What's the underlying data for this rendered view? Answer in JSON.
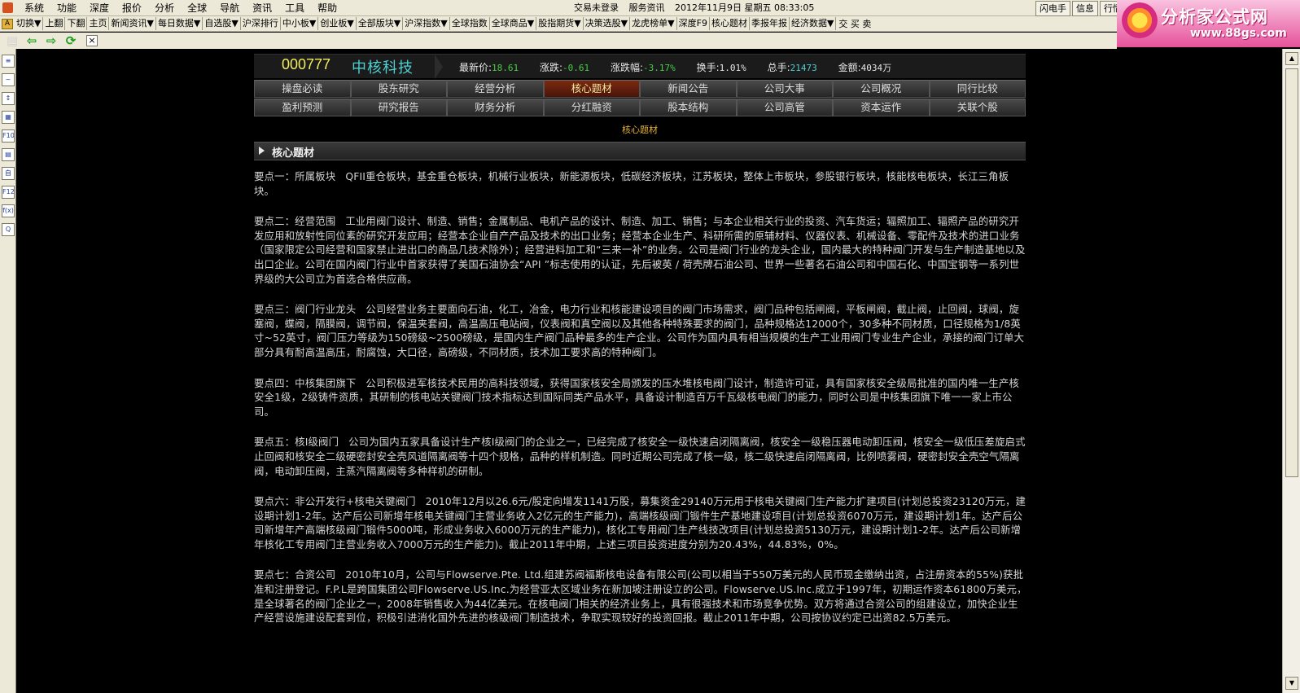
{
  "menubar": {
    "items": [
      "系统",
      "功能",
      "深度",
      "报价",
      "分析",
      "全球",
      "导航",
      "资讯",
      "工具",
      "帮助"
    ],
    "trade_status": "交易未登录",
    "service": "服务资讯",
    "datetime": "2012年11月9日 星期五 08:33:05",
    "right_buttons": [
      "闪电手",
      "信息",
      "行情"
    ]
  },
  "brand": {
    "name": "分析家公式网",
    "url": "www.88gs.com"
  },
  "toolbar": {
    "lead": "A",
    "items": [
      "切换▼",
      "上翻",
      "下翻",
      "主页",
      "新闻资讯▼",
      "每日数据▼",
      "自选股▼",
      "沪深排行",
      "中小板▼",
      "创业板▼",
      "全部版块▼",
      "沪深指数▼",
      "全球指数",
      "全球商品▼",
      "股指期货▼",
      "决策选股▼",
      "龙虎榜单▼",
      "深度F9",
      "核心题材",
      "季报年报",
      "经济数据▼"
    ],
    "end": "交 买 卖"
  },
  "navbar": {
    "close": "×"
  },
  "left_tools": [
    "≡",
    "~",
    "↕",
    "▦",
    "F10",
    "▤",
    "自",
    "F12",
    "f(x)",
    "Q"
  ],
  "stock": {
    "code": "000777",
    "name": "中核科技",
    "price_label": "最新价:",
    "price": "18.61",
    "change_label": "涨跌:",
    "change": "-0.61",
    "pct_label": "涨跌幅:",
    "pct": "-3.17%",
    "turnover_label": "换手:",
    "turnover": "1.01%",
    "volume_label": "总手:",
    "volume": "21473",
    "amount_label": "金额:",
    "amount": "4034万"
  },
  "colors": {
    "price": "#44d044",
    "change": "#44d044",
    "pct": "#44d044",
    "turnover": "#e6e6e6",
    "volume": "#4fd0d0",
    "amount": "#e6e6e6"
  },
  "tabs": {
    "row1": [
      "操盘必读",
      "股东研究",
      "经营分析",
      "核心题材",
      "新闻公告",
      "公司大事",
      "公司概况",
      "同行比较"
    ],
    "row2": [
      "盈利预测",
      "研究报告",
      "财务分析",
      "分红融资",
      "股本结构",
      "公司高管",
      "资本运作",
      "关联个股"
    ],
    "active": "核心题材"
  },
  "subtitle": "核心题材",
  "section": {
    "title": "核心题材"
  },
  "points": [
    {
      "title": "要点一：所属板块",
      "text": "QFII重仓板块，基金重仓板块，机械行业板块，新能源板块，低碳经济板块，江苏板块，整体上市板块，参股银行板块，核能核电板块，长江三角板块。"
    },
    {
      "title": "要点二：经营范围",
      "text": "工业用阀门设计、制造、销售；金属制品、电机产品的设计、制造、加工、销售；与本企业相关行业的投资、汽车货运；辐照加工、辐照产品的研究开发应用和放射性同位素的研究开发应用；经营本企业自产产品及技术的出口业务；经营本企业生产、科研所需的原辅材料、仪器仪表、机械设备、零配件及技术的进口业务（国家限定公司经营和国家禁止进出口的商品几技术除外）；经营进料加工和“三来一补”的业务。公司是阀门行业的龙头企业，国内最大的特种阀门开发与生产制造基地以及出口企业。公司在国内阀门行业中首家获得了美国石油协会“API ”标志使用的认证，先后被英 / 荷壳牌石油公司、世界一些著名石油公司和中国石化、中国宝钢等一系列世界级的大公司立为首选合格供应商。"
    },
    {
      "title": "要点三：阀门行业龙头",
      "text": "公司经营业务主要面向石油，化工，冶金，电力行业和核能建设项目的阀门市场需求，阀门品种包括闸阀，平板闸阀，截止阀，止回阀，球阀，旋塞阀，蝶阀，隔膜阀，调节阀，保温夹套阀，高温高压电站阀，仪表阀和真空阀以及其他各种特殊要求的阀门，品种规格达12000个，30多种不同材质，口径规格为1/8英寸~52英寸，阀门压力等级为150磅级~2500磅级，是国内生产阀门品种最多的生产企业。公司作为国内具有相当规模的生产工业用阀门专业生产企业，承接的阀门订单大部分具有耐高温高压，耐腐蚀，大口径，高磅级，不同材质，技术加工要求高的特种阀门。"
    },
    {
      "title": "要点四：中核集团旗下",
      "text": "公司积极进军核技术民用的高科技领域，获得国家核安全局颁发的压水堆核电阀门设计，制造许可证，具有国家核安全级局批准的国内唯一生产核安全1级，2级铸件资质，其研制的核电站关键阀门技术指标达到国际同类产品水平，具备设计制造百万千瓦级核电阀门的能力，同时公司是中核集团旗下唯一一家上市公司。"
    },
    {
      "title": "要点五：核I级阀门",
      "text": "公司为国内五家具备设计生产核I级阀门的企业之一，已经完成了核安全一级快速启闭隔离阀，核安全一级稳压器电动卸压阀，核安全一级低压差旋启式止回阀和核安全二级硬密封安全壳风道隔离阀等十四个规格，品种的样机制造。同时近期公司完成了核一级，核二级快速启闭隔离阀，比例喷雾阀，硬密封安全壳空气隔离阀，电动卸压阀，主蒸汽隔离阀等多种样机的研制。"
    },
    {
      "title": "要点六：非公开发行+核电关键阀门",
      "text": "2010年12月以26.6元/股定向增发1141万股，募集资金29140万元用于核电关键阀门生产能力扩建项目(计划总投资23120万元，建设期计划1-2年。达产后公司新增年核电关键阀门主营业务收入2亿元的生产能力)，高端核级阀门锻件生产基地建设项目(计划总投资6070万元，建设期计划1年。达产后公司新增年产高端核级阀门锻件5000吨，形成业务收入6000万元的生产能力)，核化工专用阀门生产线技改项目(计划总投资5130万元，建设期计划1-2年。达产后公司新增年核化工专用阀门主营业务收入7000万元的生产能力)。截止2011年中期，上述三项目投资进度分别为20.43%，44.83%，0%。"
    },
    {
      "title": "要点七：合资公司",
      "text": "2010年10月，公司与Flowserve.Pte. Ltd.组建苏阀福斯核电设备有限公司(公司以相当于550万美元的人民币现金缴纳出资，占注册资本的55%)获批准和注册登记。F.P.L是跨国集团公司Flowserve.US.Inc.为经营亚太区域业务在新加坡注册设立的公司。Flowserve.US.Inc.成立于1997年，初期运作资本61800万美元，是全球著名的阀门企业之一，2008年销售收入为44亿美元。在核电阀门相关的经济业务上，具有很强技术和市场竞争优势。双方将通过合资公司的组建设立，加快企业生产经营设施建设配套到位，积极引进消化国外先进的核级阀门制造技术，争取实现较好的投资回报。截止2011年中期，公司按协议约定已出资82.5万美元。"
    }
  ]
}
